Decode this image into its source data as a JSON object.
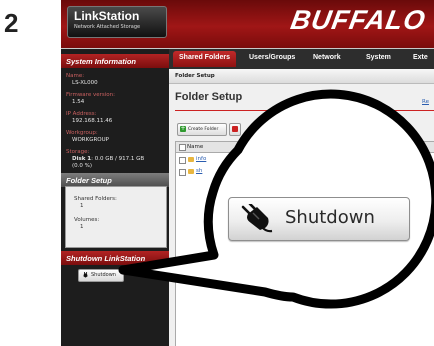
{
  "step_number": "2",
  "header": {
    "logo_title": "LinkStation",
    "logo_subtitle": "Network Attached Storage",
    "brand": "BUFFALO"
  },
  "nav": {
    "tabs": [
      {
        "label": "Shared Folders",
        "active": true
      },
      {
        "label": "Users/Groups",
        "active": false
      },
      {
        "label": "Network",
        "active": false
      },
      {
        "label": "System",
        "active": false
      },
      {
        "label": "Exte",
        "active": false
      }
    ]
  },
  "sidebar": {
    "system_info_heading": "System Information",
    "name_label": "Name:",
    "name_value": "LS-XL000",
    "firmware_label": "Firmware version:",
    "firmware_value": "1.54",
    "ip_label": "IP Address:",
    "ip_value": "192.168.11.46",
    "workgroup_label": "Workgroup:",
    "workgroup_value": "WORKGROUP",
    "storage_label": "Storage:",
    "storage_disk": "Disk 1",
    "storage_value": ": 0.0 GB / 917.1 GB",
    "storage_percent": "(0.0 %)",
    "folder_setup_heading": "Folder Setup",
    "shared_folders_label": "Shared Folders:",
    "shared_folders_value": "1",
    "volumes_label": "Volumes:",
    "volumes_value": "1",
    "shutdown_heading": "Shutdown LinkStation",
    "shutdown_button": "Shutdown"
  },
  "content": {
    "breadcrumb": "Folder Setup",
    "page_title": "Folder Setup",
    "help_link": "Re",
    "create_folder_button": "Create Folder",
    "table_header_name": "Name",
    "rows": [
      "info",
      "sh"
    ]
  },
  "callout": {
    "shutdown_label": "Shutdown",
    "icon": "power-plug-icon"
  }
}
